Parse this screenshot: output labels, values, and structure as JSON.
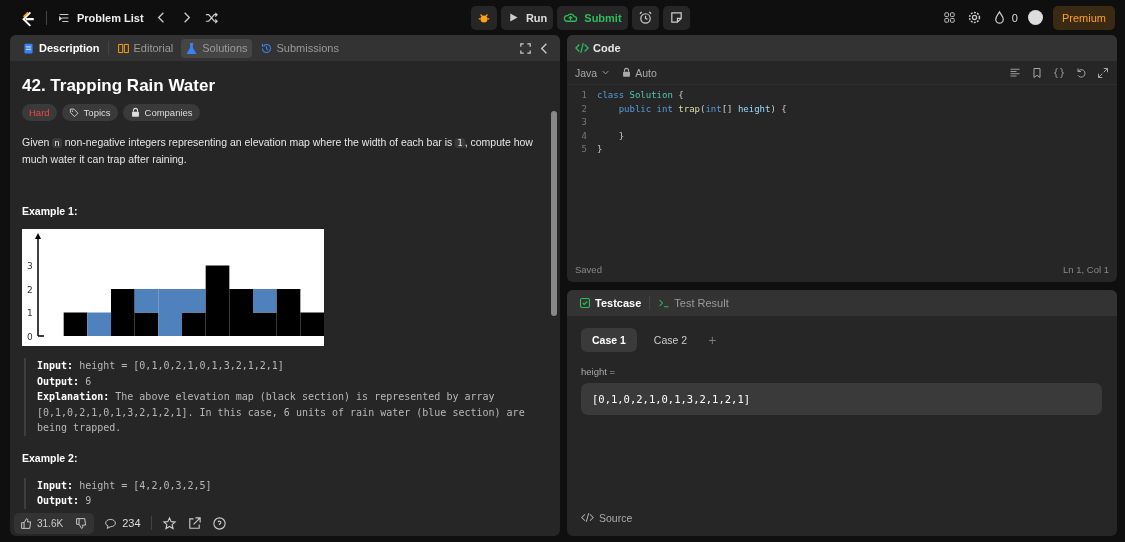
{
  "top_bar": {
    "problem_list": "Problem List",
    "run": "Run",
    "submit": "Submit",
    "streak": "0",
    "premium": "Premium"
  },
  "description_panel": {
    "tabs": [
      {
        "label": "Description",
        "selected": true,
        "highlighted": false
      },
      {
        "label": "Editorial",
        "selected": false,
        "highlighted": false
      },
      {
        "label": "Solutions",
        "selected": false,
        "highlighted": true
      },
      {
        "label": "Submissions",
        "selected": false,
        "highlighted": false
      }
    ],
    "title": "42. Trapping Rain Water",
    "tags": [
      {
        "label": "Hard",
        "kind": "difficulty"
      },
      {
        "label": "Topics",
        "kind": "topics"
      },
      {
        "label": "Companies",
        "kind": "companies"
      }
    ],
    "statement": [
      {
        "kind": "text",
        "text": "Given "
      },
      {
        "kind": "code",
        "text": "n"
      },
      {
        "kind": "text",
        "text": " non-negative integers representing an elevation map where the width of each bar is "
      },
      {
        "kind": "code",
        "text": "1"
      },
      {
        "kind": "text",
        "text": ", compute how much water it can trap after raining."
      }
    ],
    "examples": [
      {
        "heading": "Example 1:",
        "figure": {
          "axis_labels": [
            "3",
            "2",
            "1",
            "0"
          ]
        },
        "lines": [
          "**Input:** height = [0,1,0,2,1,0,1,3,2,1,2,1]",
          "**Output:** 6",
          "**Explanation:** The above elevation map (black section) is represented by array [0,1,0,2,1,0,1,3,2,1,2,1]. In this case, 6 units of rain water (blue section) are being trapped."
        ]
      },
      {
        "heading": "Example 2:",
        "lines": [
          "**Input:** height = [4,2,0,3,2,5]",
          "**Output:** 9"
        ]
      }
    ],
    "footer": {
      "likes": "31.6K",
      "comments": "234"
    }
  },
  "code_panel": {
    "title": "Code",
    "language": "Java",
    "mode": "Auto",
    "lines": [
      {
        "number": "1",
        "tokens": [
          {
            "kind": "keyword",
            "text": "class"
          },
          {
            "kind": "type",
            "text": " Solution"
          },
          {
            "kind": "plain",
            "text": " {"
          }
        ]
      },
      {
        "number": "2",
        "tokens": [
          {
            "kind": "keyword",
            "text": "    public"
          },
          {
            "kind": "keyword",
            "text": " int"
          },
          {
            "kind": "func",
            "text": " trap"
          },
          {
            "kind": "plain",
            "text": "("
          },
          {
            "kind": "keyword",
            "text": "int"
          },
          {
            "kind": "plain",
            "text": "[]"
          },
          {
            "kind": "param",
            "text": " height"
          },
          {
            "kind": "plain",
            "text": ") {"
          }
        ]
      },
      {
        "number": "3"
      },
      {
        "number": "4",
        "tokens": [
          {
            "kind": "plain",
            "text": "    }"
          }
        ]
      },
      {
        "number": "5",
        "tokens": [
          {
            "kind": "plain",
            "text": "}"
          }
        ]
      }
    ],
    "status": "Saved",
    "cursor": "Ln 1, Col 1"
  },
  "test_panel": {
    "tabs": [
      {
        "label": "Testcase",
        "selected": true
      },
      {
        "label": "Test Result",
        "selected": false
      }
    ],
    "cases": [
      {
        "label": "Case 1",
        "selected": true
      },
      {
        "label": "Case 2",
        "selected": false
      }
    ],
    "add": "+",
    "param_label": "height =",
    "param_value": "[0,1,0,2,1,0,1,3,2,1,2,1]",
    "source": "Source"
  }
}
